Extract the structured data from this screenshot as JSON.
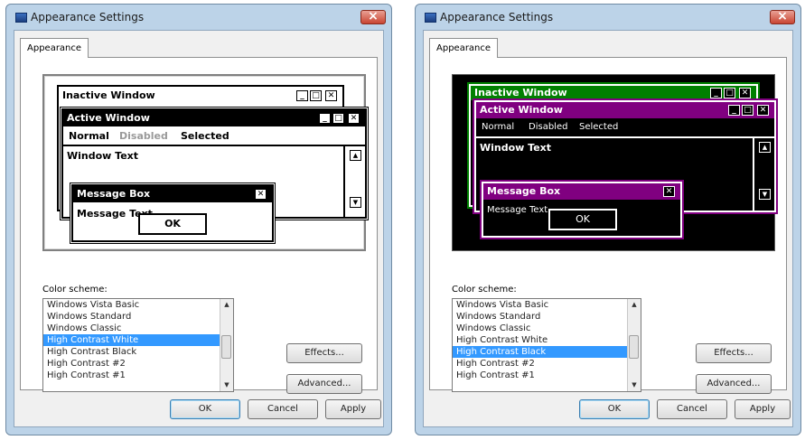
{
  "dialogs": [
    {
      "title": "Appearance Settings",
      "tab": "Appearance",
      "preview": {
        "inactive_title": "Inactive Window",
        "active_title": "Active Window",
        "menu": [
          "Normal",
          "Disabled",
          "Selected"
        ],
        "window_text": "Window Text",
        "message_box_title": "Message Box",
        "message_text": "Message Text",
        "ok": "OK"
      },
      "color_scheme_label": "Color scheme:",
      "schemes": [
        "Windows Vista Basic",
        "Windows Standard",
        "Windows Classic",
        "High Contrast White",
        "High Contrast Black",
        "High Contrast #2",
        "High Contrast #1"
      ],
      "selected_scheme": "High Contrast White",
      "effects_button": "Effects...",
      "advanced_button": "Advanced...",
      "ok_button": "OK",
      "cancel_button": "Cancel",
      "apply_button": "Apply"
    },
    {
      "title": "Appearance Settings",
      "tab": "Appearance",
      "preview": {
        "inactive_title": "Inactive Window",
        "active_title": "Active Window",
        "menu": [
          "Normal",
          "Disabled",
          "Selected"
        ],
        "window_text": "Window Text",
        "message_box_title": "Message Box",
        "message_text": "Message Text",
        "ok": "OK"
      },
      "color_scheme_label": "Color scheme:",
      "schemes": [
        "Windows Vista Basic",
        "Windows Standard",
        "Windows Classic",
        "High Contrast White",
        "High Contrast Black",
        "High Contrast #2",
        "High Contrast #1"
      ],
      "selected_scheme": "High Contrast Black",
      "effects_button": "Effects...",
      "advanced_button": "Advanced...",
      "ok_button": "OK",
      "cancel_button": "Cancel",
      "apply_button": "Apply"
    }
  ],
  "colors": {
    "dialog_frame": "#bcd3e8",
    "selection": "#3399ff",
    "hc_white_active_title": "#000000",
    "hc_black_inactive_title": "#008000",
    "hc_black_active_title": "#800080"
  }
}
